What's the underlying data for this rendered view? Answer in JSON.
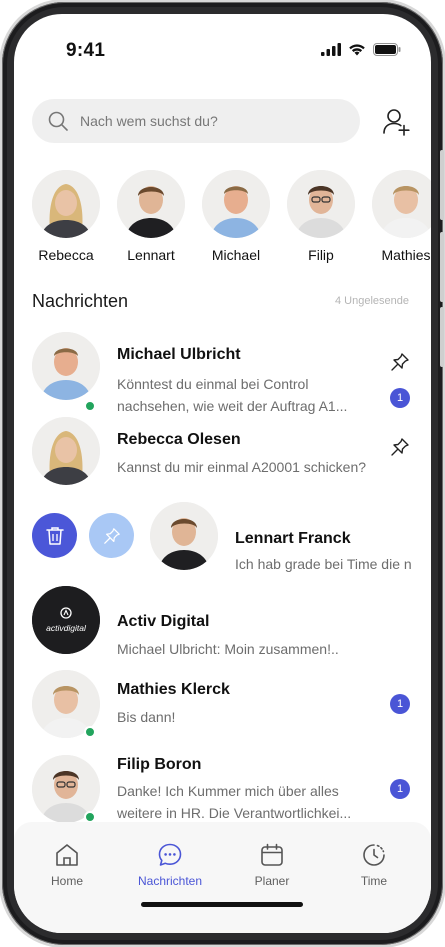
{
  "status_bar": {
    "time": "9:41"
  },
  "search": {
    "placeholder": "Nach wem suchst du?"
  },
  "stories": [
    {
      "name": "Rebecca"
    },
    {
      "name": "Lennart"
    },
    {
      "name": "Michael"
    },
    {
      "name": "Filip"
    },
    {
      "name": "Mathies"
    }
  ],
  "section": {
    "title": "Nachrichten",
    "unread": "4 Ungelesende"
  },
  "chats": [
    {
      "name": "Michael Ulbricht",
      "message": "Könntest du einmal bei Control nachsehen, wie weit der Auftrag A1...",
      "badge": "1"
    },
    {
      "name": "Rebecca Olesen",
      "message": "Kannst du mir einmal A20001 schicken?"
    },
    {
      "name": "Lennart Franck",
      "message": "Ich hab grade bei Time die n"
    },
    {
      "name": "Activ Digital",
      "message": "Michael Ulbricht: Moin zusammen!..",
      "logo_text": "activdigital"
    },
    {
      "name": "Mathies Klerck",
      "message": "Bis dann!",
      "badge": "1"
    },
    {
      "name": "Filip Boron",
      "message": "Danke! Ich Kummer mich über alles weitere in HR. Die Verantwortlichkei...",
      "badge": "1"
    }
  ],
  "tabs": [
    {
      "label": "Home",
      "icon": "home-icon"
    },
    {
      "label": "Nachrichten",
      "icon": "chat-icon"
    },
    {
      "label": "Planer",
      "icon": "calendar-icon"
    },
    {
      "label": "Time",
      "icon": "clock-icon"
    }
  ],
  "colors": {
    "accent": "#4a55d6",
    "online": "#22a45d",
    "pin_action": "#a9c8f5"
  }
}
